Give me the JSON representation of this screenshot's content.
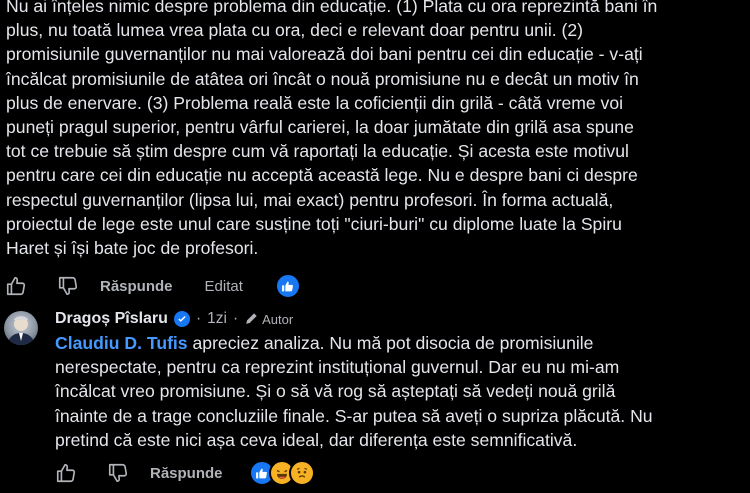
{
  "comment": {
    "lines": [
      "Nu ai înțeles nimic despre problema din educație. (1) Plata cu ora reprezintă bani în",
      "plus, nu toată lumea vrea plata cu ora, deci e relevant doar pentru unii. (2)",
      "promisiunile guvernanților nu mai valorează doi bani pentru cei din educație - v-ați",
      "încălcat promisiunile de atâtea ori încât o nouă promisiune nu e decât un motiv în",
      "plus de enervare. (3) Problema reală este la coficienții din grilă - câtă vreme voi",
      "puneți pragul superior, pentru vârful carierei, la doar jumătate din grilă asa spune",
      "tot ce trebuie să știm despre cum vă raportați la educație. Și acesta este motivul",
      "pentru care cei din educație nu acceptă această lege. Nu e despre bani ci despre",
      "respectul guvernanților (lipsa lui, mai exact) pentru profesori. În forma actuală,",
      "proiectul de lege este unul care susține toți \"ciuri-buri\" cu diplome luate la Spiru",
      "Haret și își bate joc de profesori."
    ],
    "actions": {
      "reply_label": "Răspunde",
      "edited_label": "Editat"
    }
  },
  "reply": {
    "author": "Dragoș Pîslaru",
    "time": "1zi",
    "separator": "·",
    "author_badge": "Autor",
    "mention": "Claudiu D. Tufis",
    "first_line_rest": " apreciez analiza. Nu mă pot disocia de promisiunile",
    "lines": [
      "nerespectate, pentru ca reprezint instituțional guvernul. Dar eu nu mi-am",
      "încălcat vreo promisiune. Și o să vă rog să așteptați să vedeți nouă grilă",
      "înainte de a trage concluziile finale. S-ar putea să aveți o supriza plăcută. Nu",
      "pretind că este nici așa ceva ideal, dar diferența este semnificativă."
    ],
    "actions": {
      "reply_label": "Răspunde"
    }
  },
  "colors": {
    "background": "#000000",
    "text": "#e4e6eb",
    "secondary": "#b0b3b8",
    "mention": "#4599ff",
    "like_blue": "#1877f2"
  }
}
